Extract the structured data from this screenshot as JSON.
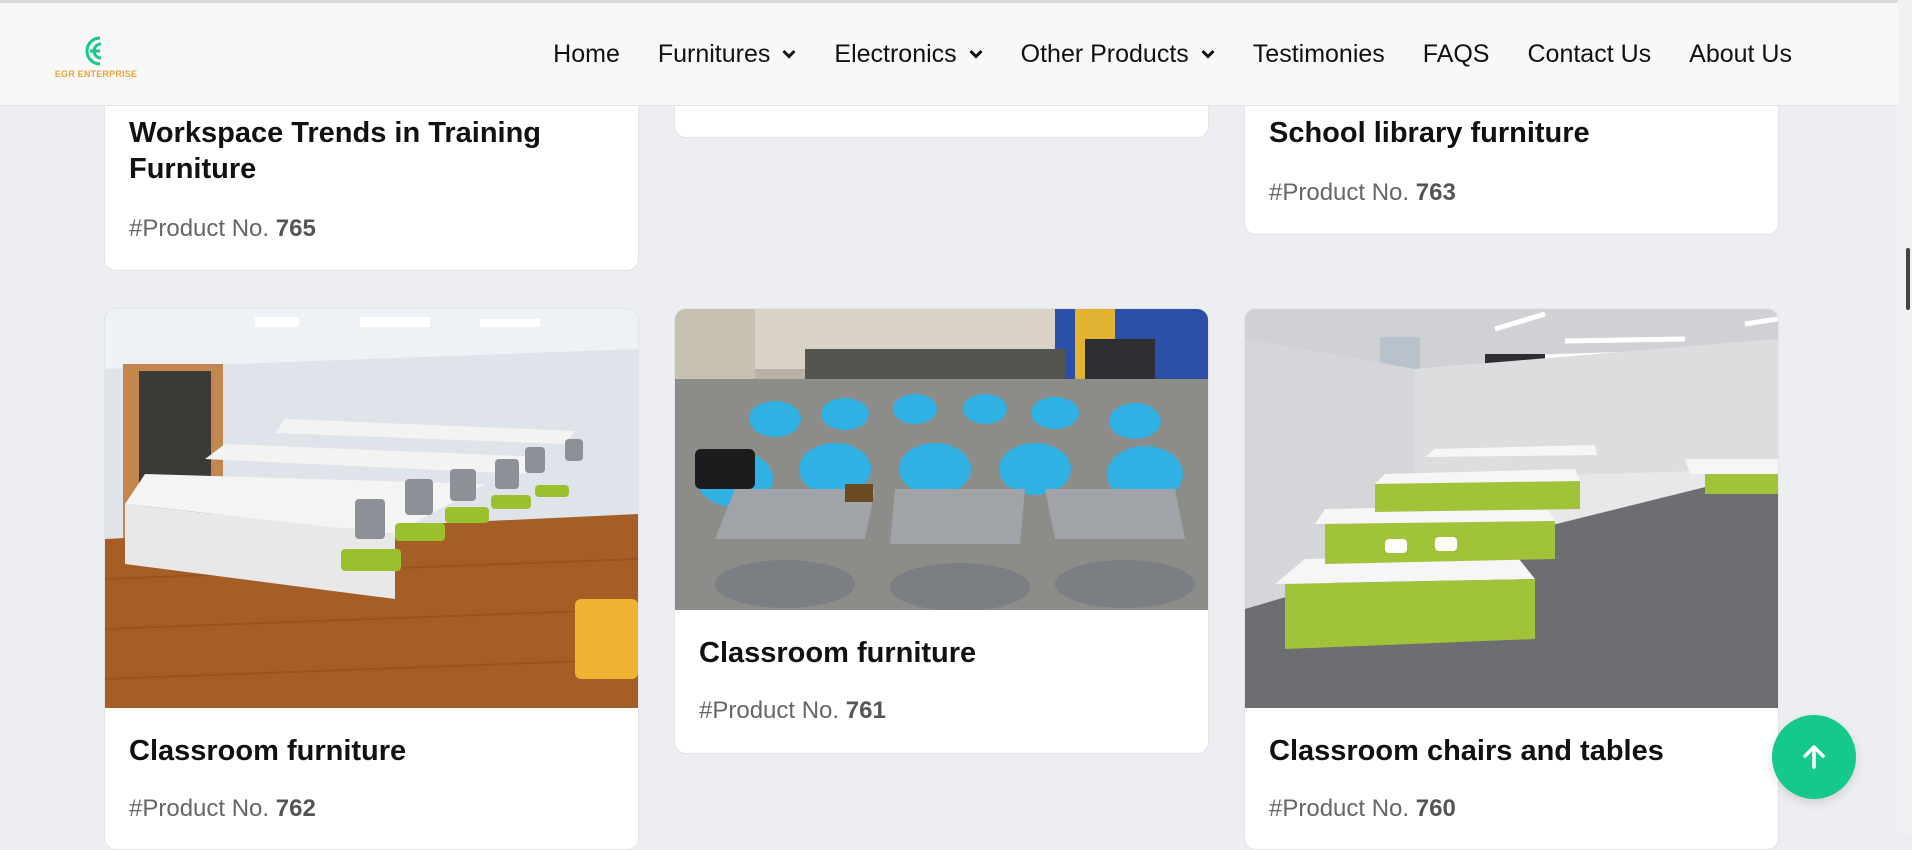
{
  "brand": {
    "name": "EGR ENTERPRISE",
    "accent": "#14c98a",
    "logo_color": "#e8a33a"
  },
  "nav": {
    "items": [
      {
        "label": "Home",
        "dropdown": false
      },
      {
        "label": "Furnitures",
        "dropdown": true
      },
      {
        "label": "Electronics",
        "dropdown": true
      },
      {
        "label": "Other Products",
        "dropdown": true
      },
      {
        "label": "Testimonies",
        "dropdown": false
      },
      {
        "label": "FAQS",
        "dropdown": false
      },
      {
        "label": "Contact Us",
        "dropdown": false
      },
      {
        "label": "About Us",
        "dropdown": false
      }
    ]
  },
  "product_prefix": "#Product No.",
  "products": [
    {
      "title": "Workspace Trends in Training Furniture",
      "number": "765"
    },
    {
      "title": "School library furniture",
      "number": "763"
    },
    {
      "title": "Classroom furniture",
      "number": "762"
    },
    {
      "title": "Classroom furniture",
      "number": "761"
    },
    {
      "title": "Classroom chairs and tables",
      "number": "760"
    }
  ],
  "icons": {
    "back_to_top": "arrow-up-icon",
    "dropdown": "chevron-down-icon"
  }
}
